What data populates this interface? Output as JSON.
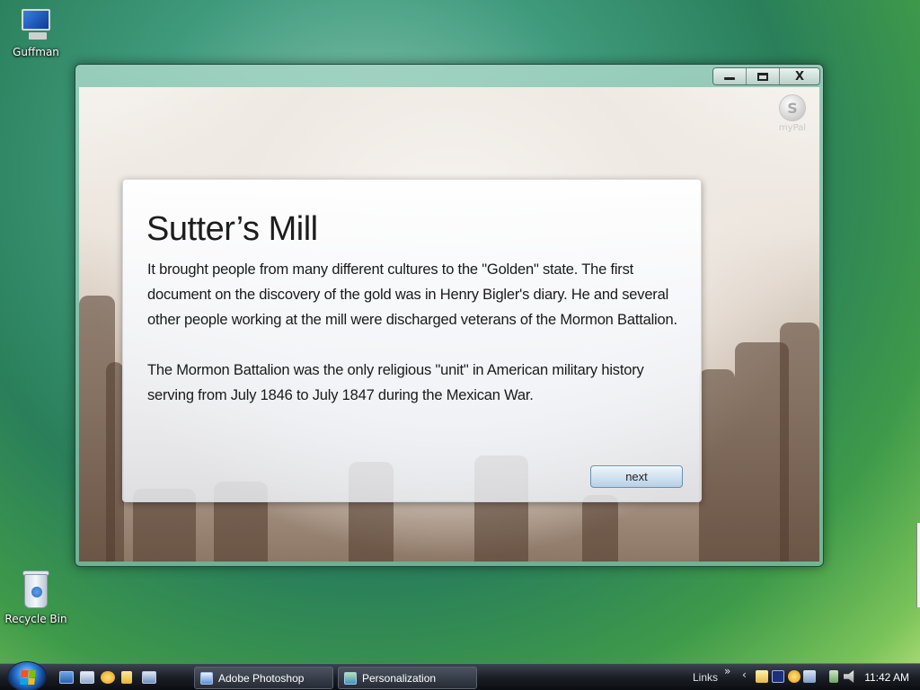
{
  "desktop": {
    "icons": [
      {
        "label": "Guffman",
        "icon": "computer-icon"
      },
      {
        "label": "Recycle Bin",
        "icon": "recycle-bin-icon"
      }
    ]
  },
  "window": {
    "controls": {
      "minimize": "minimize",
      "maximize": "maximize",
      "close": "X"
    },
    "brand": {
      "label": "myPal",
      "icon": "mypal-logo-icon"
    },
    "panel": {
      "title": "Sutter’s Mill",
      "paragraph1": "It brought people from many different cultures to the \"Golden\" state. The first document on the discovery of the gold was in Henry Bigler's diary. He and several other people working at the mill were discharged veterans of the Mormon Battalion.",
      "paragraph2": "The Mormon Battalion was the only religious \"unit\" in American military history serving from July 1846 to July 1847 during the Mexican War.",
      "next_label": "next"
    }
  },
  "taskbar": {
    "start_icon": "windows-start-orb-icon",
    "quick_launch": [
      "show-desktop-icon",
      "switch-windows-icon",
      "messenger-icon",
      "folder-icon",
      "network-icon"
    ],
    "tasks": [
      {
        "label": "Adobe Photoshop",
        "icon": "photoshop-icon"
      },
      {
        "label": "Personalization",
        "icon": "personalization-icon"
      }
    ],
    "links_label": "Links",
    "links_chevron": "»",
    "tray_chevron": "‹",
    "tray_icons": [
      "mail-icon",
      "performance-icon",
      "messenger-tray-icon",
      "display-icon",
      "network-tray-icon",
      "volume-icon"
    ],
    "clock": "11:42 AM"
  }
}
